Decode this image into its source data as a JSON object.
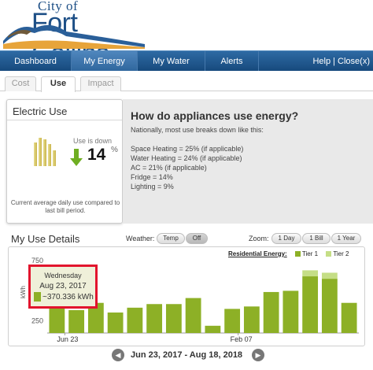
{
  "logo": {
    "city": "City of",
    "name": "Fort Collins"
  },
  "nav": {
    "items": [
      {
        "label": "Dashboard"
      },
      {
        "label": "My Energy"
      },
      {
        "label": "My Water"
      },
      {
        "label": "Alerts"
      }
    ],
    "right": "Help | Close(x)"
  },
  "subtabs": [
    {
      "label": "Cost"
    },
    {
      "label": "Use"
    },
    {
      "label": "Impact"
    }
  ],
  "electric": {
    "title": "Electric Use",
    "status": "Use is down",
    "percent": "14",
    "percent_symbol": "%",
    "note": "Current average daily use compared to last bill period."
  },
  "info": {
    "question": "How do appliances use energy?",
    "intro": "Nationally, most use breaks down like this:",
    "items": [
      "Space Heating = 25% (if applicable)",
      "Water Heating = 24% (if applicable)",
      "AC = 21% (if applicable)",
      "Fridge = 14%",
      "Lighting = 9%"
    ]
  },
  "details": {
    "title": "My Use Details",
    "weather_label": "Weather:",
    "weather_options": [
      "Temp",
      "Off"
    ],
    "zoom_label": "Zoom:",
    "zoom_options": [
      "1 Day",
      "1 Bill",
      "1 Year"
    ]
  },
  "legend": {
    "label": "Residential Energy:",
    "tier1": "Tier 1",
    "tier2": "Tier 2"
  },
  "colors": {
    "tier1": "#8db026",
    "tier2": "#c5de86",
    "nav": "#1f568f",
    "highlight": "#e2142d"
  },
  "tooltip": {
    "day": "Wednesday",
    "date": "Aug 23, 2017",
    "value": "~370.336 kWh"
  },
  "range": {
    "text": "Jun 23, 2017 - Aug 18, 2018",
    "prev_icon": "arrow-left-icon",
    "next_icon": "arrow-right-icon"
  },
  "chart_data": {
    "type": "bar",
    "ylabel": "kWh",
    "yticks": [
      "750",
      "250"
    ],
    "ylim": [
      150,
      790
    ],
    "xticks": [
      "Jun 23",
      "Feb 07"
    ],
    "series": [
      {
        "name": "Tier 1",
        "values": [
          370,
          340,
          400,
          320,
          360,
          390,
          390,
          440,
          210,
          350,
          370,
          490,
          500,
          620,
          600,
          400
        ]
      },
      {
        "name": "Tier 2",
        "values": [
          0,
          0,
          0,
          0,
          0,
          0,
          0,
          0,
          0,
          0,
          0,
          0,
          0,
          50,
          50,
          0
        ]
      }
    ]
  }
}
